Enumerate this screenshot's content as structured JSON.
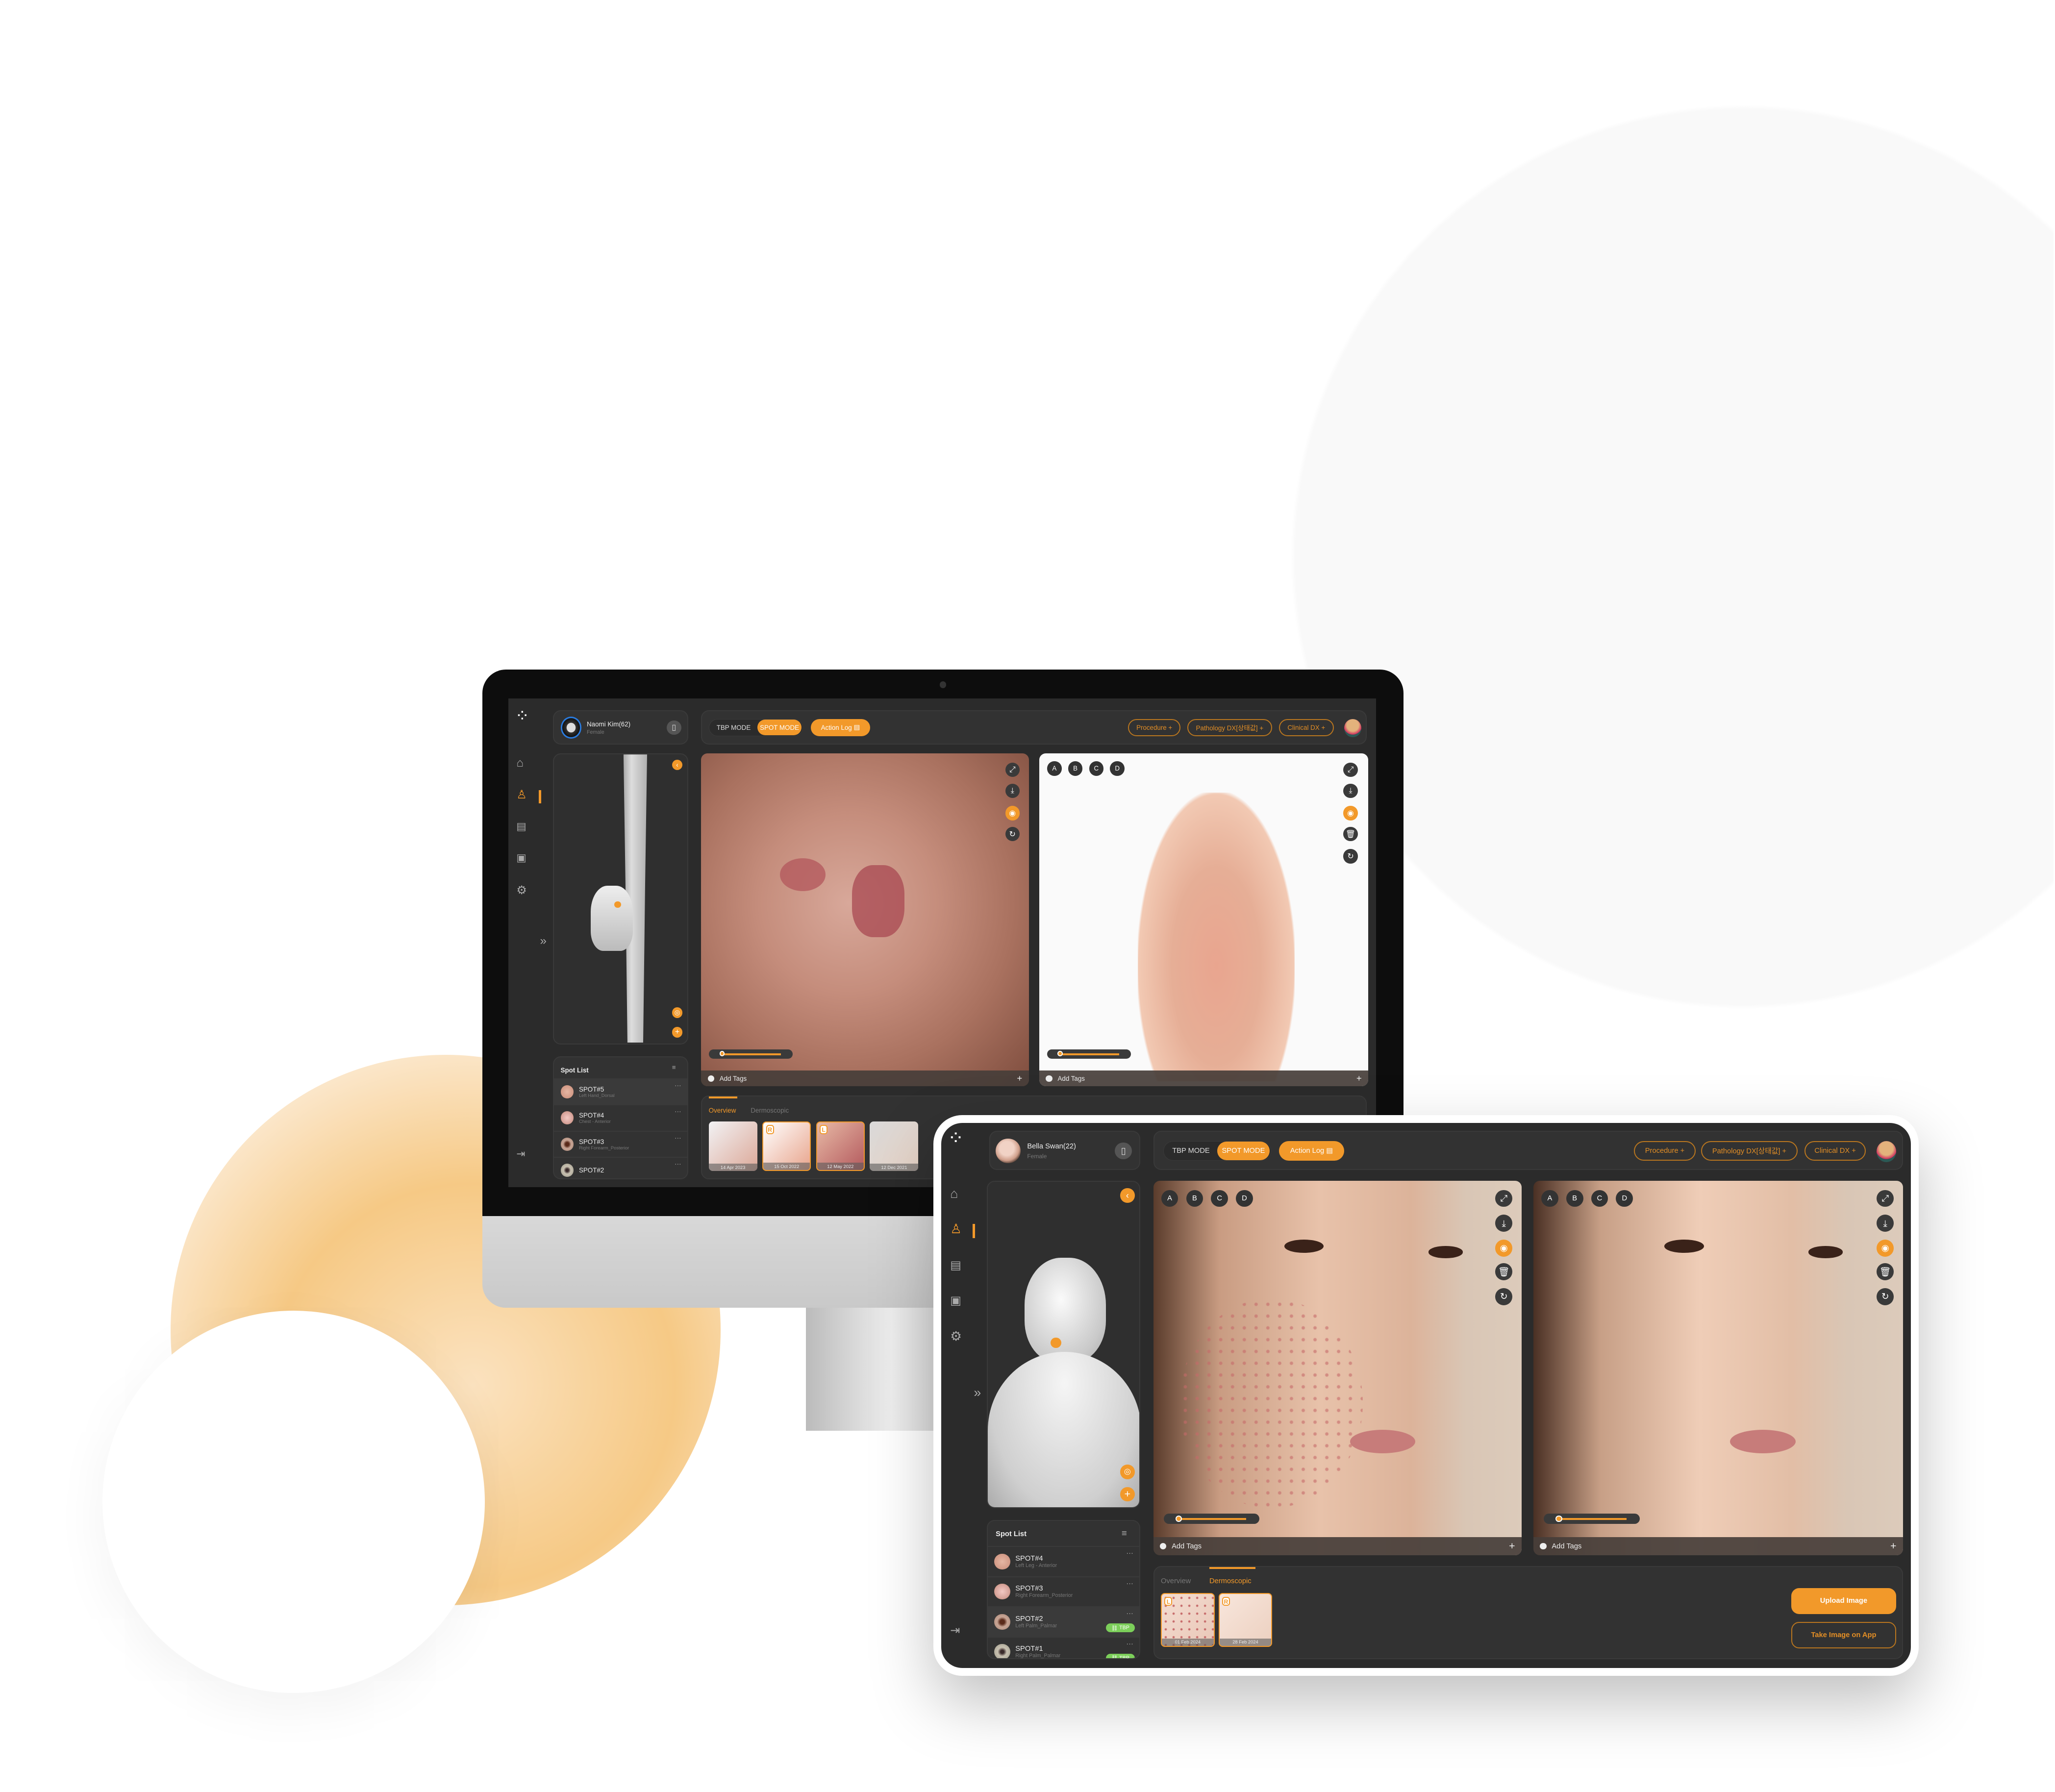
{
  "colors": {
    "accent": "#f2992a",
    "panel": "#2b2b2b",
    "tbp_badge": "#7ccf5a"
  },
  "monitor": {
    "patient": {
      "name": "Naomi Kim(62)",
      "gender": "Female"
    },
    "toolbar": {
      "tbp_mode": "TBP MODE",
      "spot_mode": "SPOT MODE",
      "action_log": "Action Log",
      "procedure": "Procedure +",
      "pathology": "Pathology DX[상태값] +",
      "clinical": "Clinical DX +"
    },
    "abcd": [
      "A",
      "B",
      "C",
      "D"
    ],
    "add_tags": "Add Tags",
    "add_icon": "+",
    "spot_list": {
      "title": "Spot List",
      "items": [
        {
          "name": "SPOT#5",
          "location": "Left Hand_Dorsal",
          "selected": true
        },
        {
          "name": "SPOT#4",
          "location": "Chest - Anterior"
        },
        {
          "name": "SPOT#3",
          "location": "Right Forearm_Posterior"
        },
        {
          "name": "SPOT#2",
          "location": ""
        }
      ]
    },
    "tabs": {
      "overview": "Overview",
      "dermoscopic": "Dermoscopic",
      "active": "overview"
    },
    "thumbs": [
      {
        "date": "14 Apr 2023",
        "tag": ""
      },
      {
        "date": "15 Oct 2022",
        "tag": "R"
      },
      {
        "date": "12 May 2022",
        "tag": "L"
      },
      {
        "date": "12 Dec 2021",
        "tag": ""
      }
    ]
  },
  "tablet": {
    "patient": {
      "name": "Bella Swan(22)",
      "gender": "Female"
    },
    "toolbar": {
      "tbp_mode": "TBP MODE",
      "spot_mode": "SPOT MODE",
      "action_log": "Action Log",
      "procedure": "Procedure +",
      "pathology": "Pathology DX[상태값] +",
      "clinical": "Clinical DX +"
    },
    "abcd": [
      "A",
      "B",
      "C",
      "D"
    ],
    "add_tags": "Add Tags",
    "add_icon": "+",
    "spot_list": {
      "title": "Spot List",
      "items": [
        {
          "name": "SPOT#4",
          "location": "Left Leg - Anterior"
        },
        {
          "name": "SPOT#3",
          "location": "Right Forearm_Posterior"
        },
        {
          "name": "SPOT#2",
          "location": "Left Palm_Palmar",
          "badge": "TBP",
          "selected": true
        },
        {
          "name": "SPOT#1",
          "location": "Right Palm_Palmar",
          "badge": "TBP"
        }
      ]
    },
    "tabs": {
      "overview": "Overview",
      "dermoscopic": "Dermoscopic",
      "active": "dermoscopic"
    },
    "thumbs": [
      {
        "date": "01 Feb 2024",
        "tag": "L"
      },
      {
        "date": "28 Feb 2024",
        "tag": "R"
      }
    ],
    "upload_image": "Upload Image",
    "take_image": "Take Image on App"
  }
}
